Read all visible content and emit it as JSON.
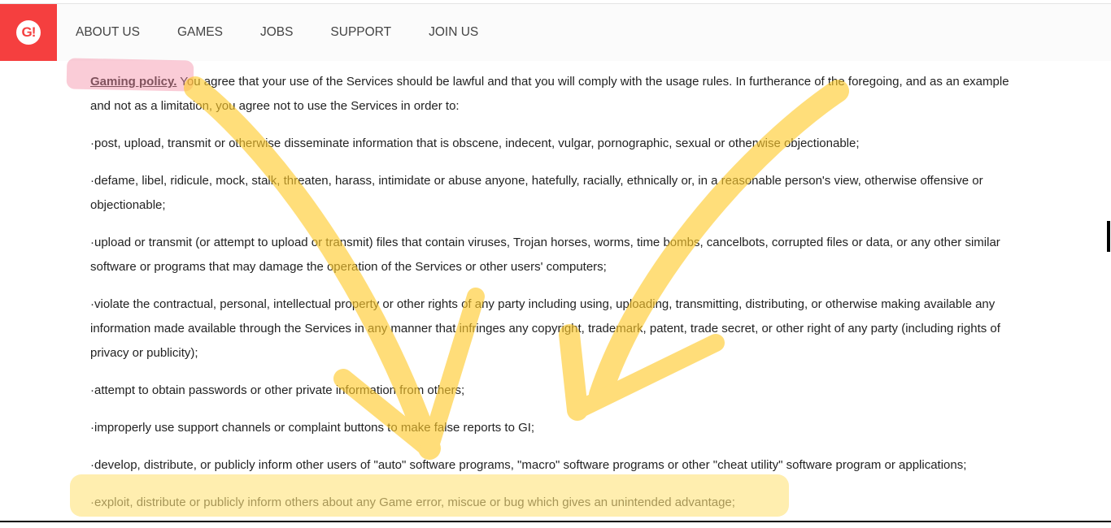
{
  "header": {
    "logo_text": "G!",
    "nav": [
      {
        "label": "ABOUT US"
      },
      {
        "label": "GAMES"
      },
      {
        "label": "JOBS"
      },
      {
        "label": "SUPPORT"
      },
      {
        "label": "JOIN US"
      }
    ]
  },
  "policy": {
    "title": "Gaming policy.",
    "intro": " You agree that your use of the Services should be lawful and that you will comply with the usage rules. In furtherance of the foregoing, and as an example and not as a limitation, you agree not to use the Services in order to:",
    "items": [
      "·post, upload, transmit or otherwise disseminate information that is obscene, indecent, vulgar, pornographic, sexual or otherwise objectionable;",
      "·defame, libel, ridicule, mock, stalk, threaten, harass, intimidate or abuse anyone, hatefully, racially, ethnically or, in a reasonable person's view, otherwise offensive or objectionable;",
      "·upload or transmit (or attempt to upload or transmit) files that contain viruses, Trojan horses, worms, time bombs, cancelbots, corrupted files or data, or any other similar software or programs that may damage the operation of the Services or other users' computers;",
      "·violate the contractual, personal, intellectual property or other rights of any party including using, uploading, transmitting, distributing, or otherwise making available any information made available through the Services in any manner that infringes any copyright, trademark, patent, trade secret, or other right of any party (including rights of privacy or publicity);",
      "·attempt to obtain passwords or other private information from others;",
      "·improperly use support channels or complaint buttons to make false reports to GI;",
      "·develop, distribute, or publicly inform other users of \"auto\" software programs, \"macro\" software programs or other \"cheat utility\" software program or applications;",
      "·exploit, distribute or publicly inform others about any Game error, miscue or bug which gives an unintended advantage;"
    ]
  },
  "annotations": {
    "title_highlight_color": "#f58fa6",
    "item_highlight_color": "#ffe27a",
    "arrow_color": "#ffc928"
  }
}
